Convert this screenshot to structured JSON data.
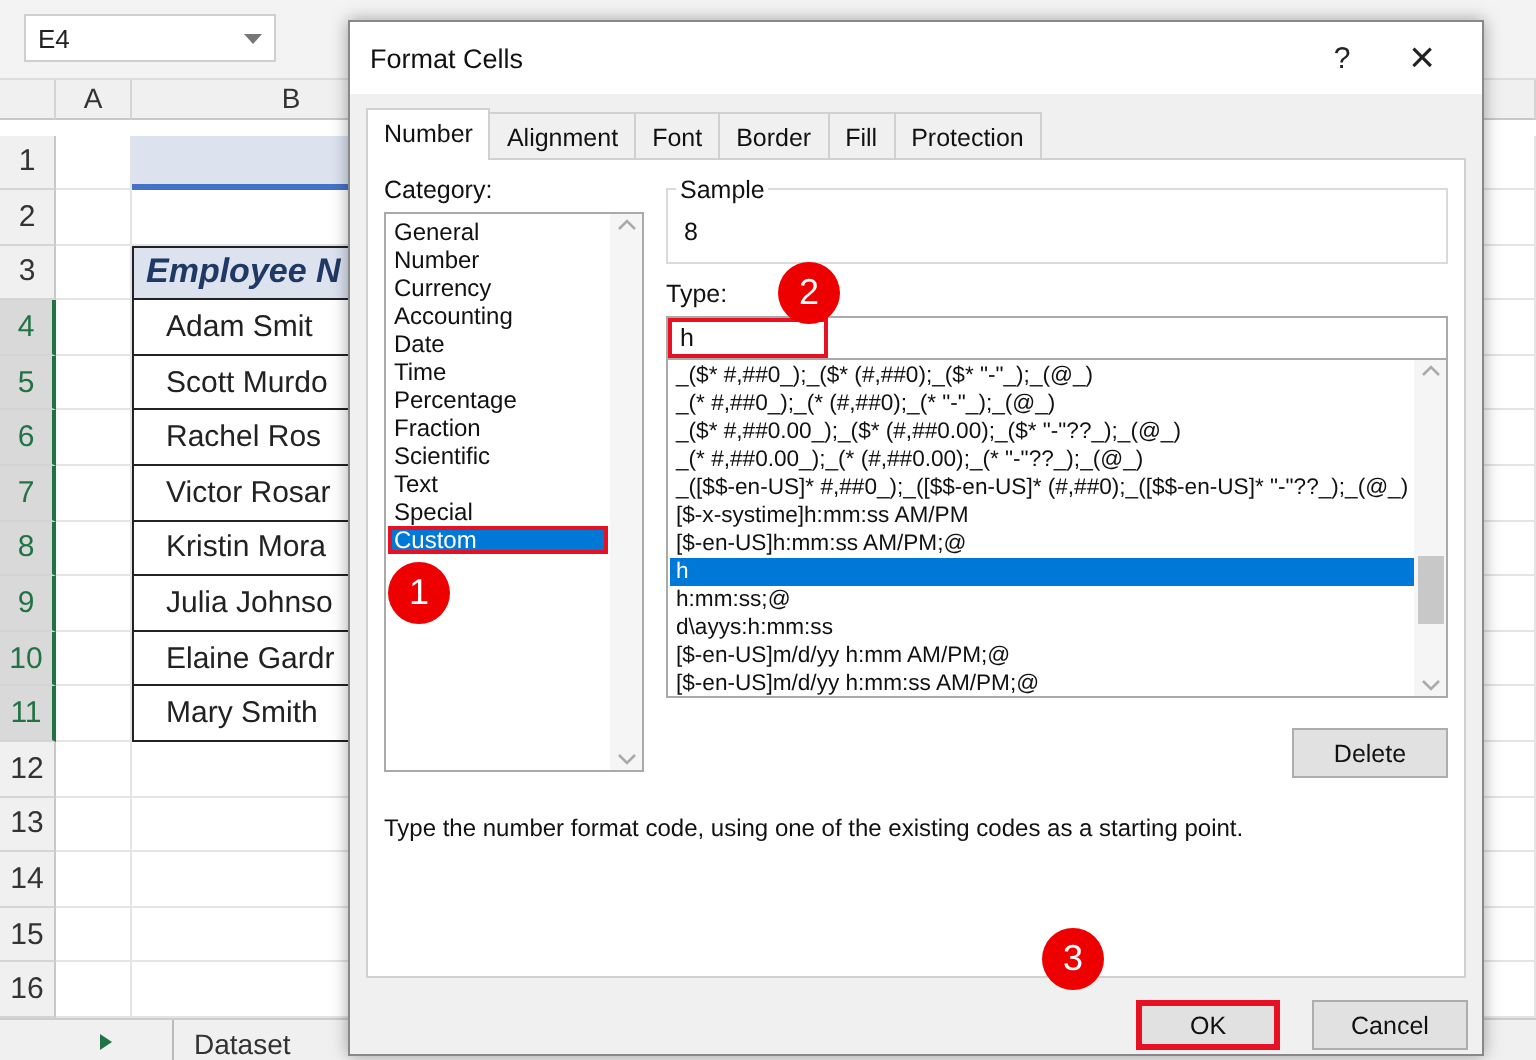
{
  "name_box": {
    "value": "E4"
  },
  "sheet": {
    "columns": [
      {
        "label": "A"
      },
      {
        "label": "B"
      }
    ],
    "rows": [
      {
        "number": "1",
        "selected": false,
        "kind": "title",
        "cell": ""
      },
      {
        "number": "2",
        "selected": false,
        "kind": "blank"
      },
      {
        "number": "3",
        "selected": false,
        "kind": "header",
        "cell": "Employee N"
      },
      {
        "number": "4",
        "selected": true,
        "kind": "data",
        "cell": "Adam Smit"
      },
      {
        "number": "5",
        "selected": true,
        "kind": "data",
        "cell": "Scott Murdo"
      },
      {
        "number": "6",
        "selected": true,
        "kind": "data",
        "cell": "Rachel Ros"
      },
      {
        "number": "7",
        "selected": true,
        "kind": "data",
        "cell": "Victor Rosar"
      },
      {
        "number": "8",
        "selected": true,
        "kind": "data",
        "cell": "Kristin Mora"
      },
      {
        "number": "9",
        "selected": true,
        "kind": "data",
        "cell": "Julia Johnso"
      },
      {
        "number": "10",
        "selected": true,
        "kind": "data",
        "cell": "Elaine Gardr"
      },
      {
        "number": "11",
        "selected": true,
        "kind": "data",
        "cell": "Mary Smith"
      },
      {
        "number": "12",
        "selected": false,
        "kind": "blank"
      },
      {
        "number": "13",
        "selected": false,
        "kind": "blank"
      },
      {
        "number": "14",
        "selected": false,
        "kind": "blank"
      },
      {
        "number": "15",
        "selected": false,
        "kind": "blank"
      },
      {
        "number": "16",
        "selected": false,
        "kind": "blank"
      }
    ],
    "sheet_tabs": [
      {
        "label": "Dataset",
        "selected": false
      }
    ]
  },
  "dialog": {
    "title": "Format Cells",
    "help": "?",
    "close": "×",
    "tabs": [
      {
        "label": "Number",
        "selected": true
      },
      {
        "label": "Alignment",
        "selected": false
      },
      {
        "label": "Font",
        "selected": false
      },
      {
        "label": "Border",
        "selected": false
      },
      {
        "label": "Fill",
        "selected": false
      },
      {
        "label": "Protection",
        "selected": false
      }
    ],
    "category_label": "Category:",
    "categories": [
      {
        "label": "General",
        "selected": false,
        "highlighted": false
      },
      {
        "label": "Number",
        "selected": false,
        "highlighted": false
      },
      {
        "label": "Currency",
        "selected": false,
        "highlighted": false
      },
      {
        "label": "Accounting",
        "selected": false,
        "highlighted": false
      },
      {
        "label": "Date",
        "selected": false,
        "highlighted": false
      },
      {
        "label": "Time",
        "selected": false,
        "highlighted": false
      },
      {
        "label": "Percentage",
        "selected": false,
        "highlighted": false
      },
      {
        "label": "Fraction",
        "selected": false,
        "highlighted": false
      },
      {
        "label": "Scientific",
        "selected": false,
        "highlighted": false
      },
      {
        "label": "Text",
        "selected": false,
        "highlighted": false
      },
      {
        "label": "Special",
        "selected": false,
        "highlighted": false
      },
      {
        "label": "Custom",
        "selected": true,
        "highlighted": true
      }
    ],
    "sample_label": "Sample",
    "sample_value": "8",
    "type_label": "Type:",
    "type_value": "h",
    "type_highlighted": true,
    "formats": [
      {
        "label": "_($* #,##0_);_($* (#,##0);_($* \"-\"_);_(@_)",
        "selected": false
      },
      {
        "label": "_(* #,##0_);_(* (#,##0);_(* \"-\"_);_(@_)",
        "selected": false
      },
      {
        "label": "_($* #,##0.00_);_($* (#,##0.00);_($* \"-\"??_);_(@_)",
        "selected": false
      },
      {
        "label": "_(* #,##0.00_);_(* (#,##0.00);_(* \"-\"??_);_(@_)",
        "selected": false
      },
      {
        "label": "_([$$-en-US]* #,##0_);_([$$-en-US]* (#,##0);_([$$-en-US]* \"-\"??_);_(@_)",
        "selected": false
      },
      {
        "label": "[$-x-systime]h:mm:ss AM/PM",
        "selected": false
      },
      {
        "label": "[$-en-US]h:mm:ss AM/PM;@",
        "selected": false
      },
      {
        "label": "h",
        "selected": true
      },
      {
        "label": "h:mm:ss;@",
        "selected": false
      },
      {
        "label": "d\\ayys:h:mm:ss",
        "selected": false
      },
      {
        "label": "[$-en-US]m/d/yy h:mm AM/PM;@",
        "selected": false
      },
      {
        "label": "[$-en-US]m/d/yy h:mm:ss AM/PM;@",
        "selected": false
      }
    ],
    "delete_button": "Delete",
    "description": "Type the number format code, using one of the existing codes as a starting point.",
    "buttons": [
      {
        "label": "OK",
        "highlighted": true
      },
      {
        "label": "Cancel",
        "highlighted": false
      }
    ]
  },
  "callouts": [
    {
      "number": "1"
    },
    {
      "number": "2"
    },
    {
      "number": "3"
    }
  ]
}
